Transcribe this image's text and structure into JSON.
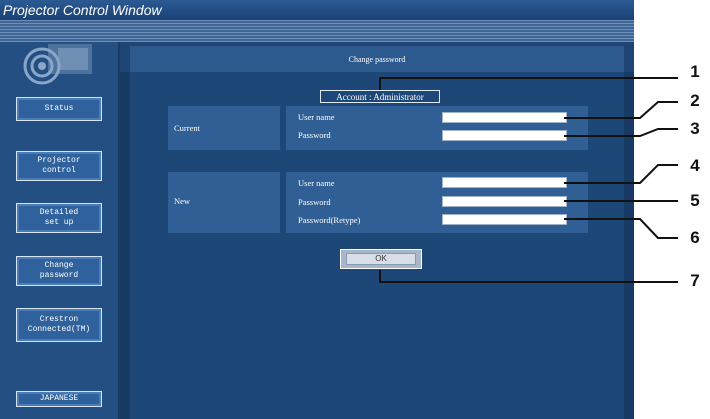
{
  "window": {
    "title": "Projector Control Window"
  },
  "sidebar": {
    "items": [
      {
        "label": "Status"
      },
      {
        "label": "Projector\ncontrol"
      },
      {
        "label": "Detailed\nset up"
      },
      {
        "label": "Change\npassword"
      },
      {
        "label": "Crestron\nConnected(TM)"
      }
    ],
    "language_button": "JAPANESE"
  },
  "panel": {
    "title": "Change password",
    "account": "Account : Administrator",
    "current": {
      "heading": "Current",
      "username_label": "User name",
      "password_label": "Password",
      "username_value": "",
      "password_value": ""
    },
    "new": {
      "heading": "New",
      "username_label": "User name",
      "password_label": "Password",
      "retype_label": "Password(Retype)",
      "username_value": "",
      "password_value": "",
      "retype_value": ""
    },
    "ok_label": "OK"
  },
  "callouts": [
    "1",
    "2",
    "3",
    "4",
    "5",
    "6",
    "7"
  ],
  "colors": {
    "background": "#173b64",
    "panel": "#1d4776",
    "box": "#2f5f94",
    "button": "#2f629c"
  }
}
